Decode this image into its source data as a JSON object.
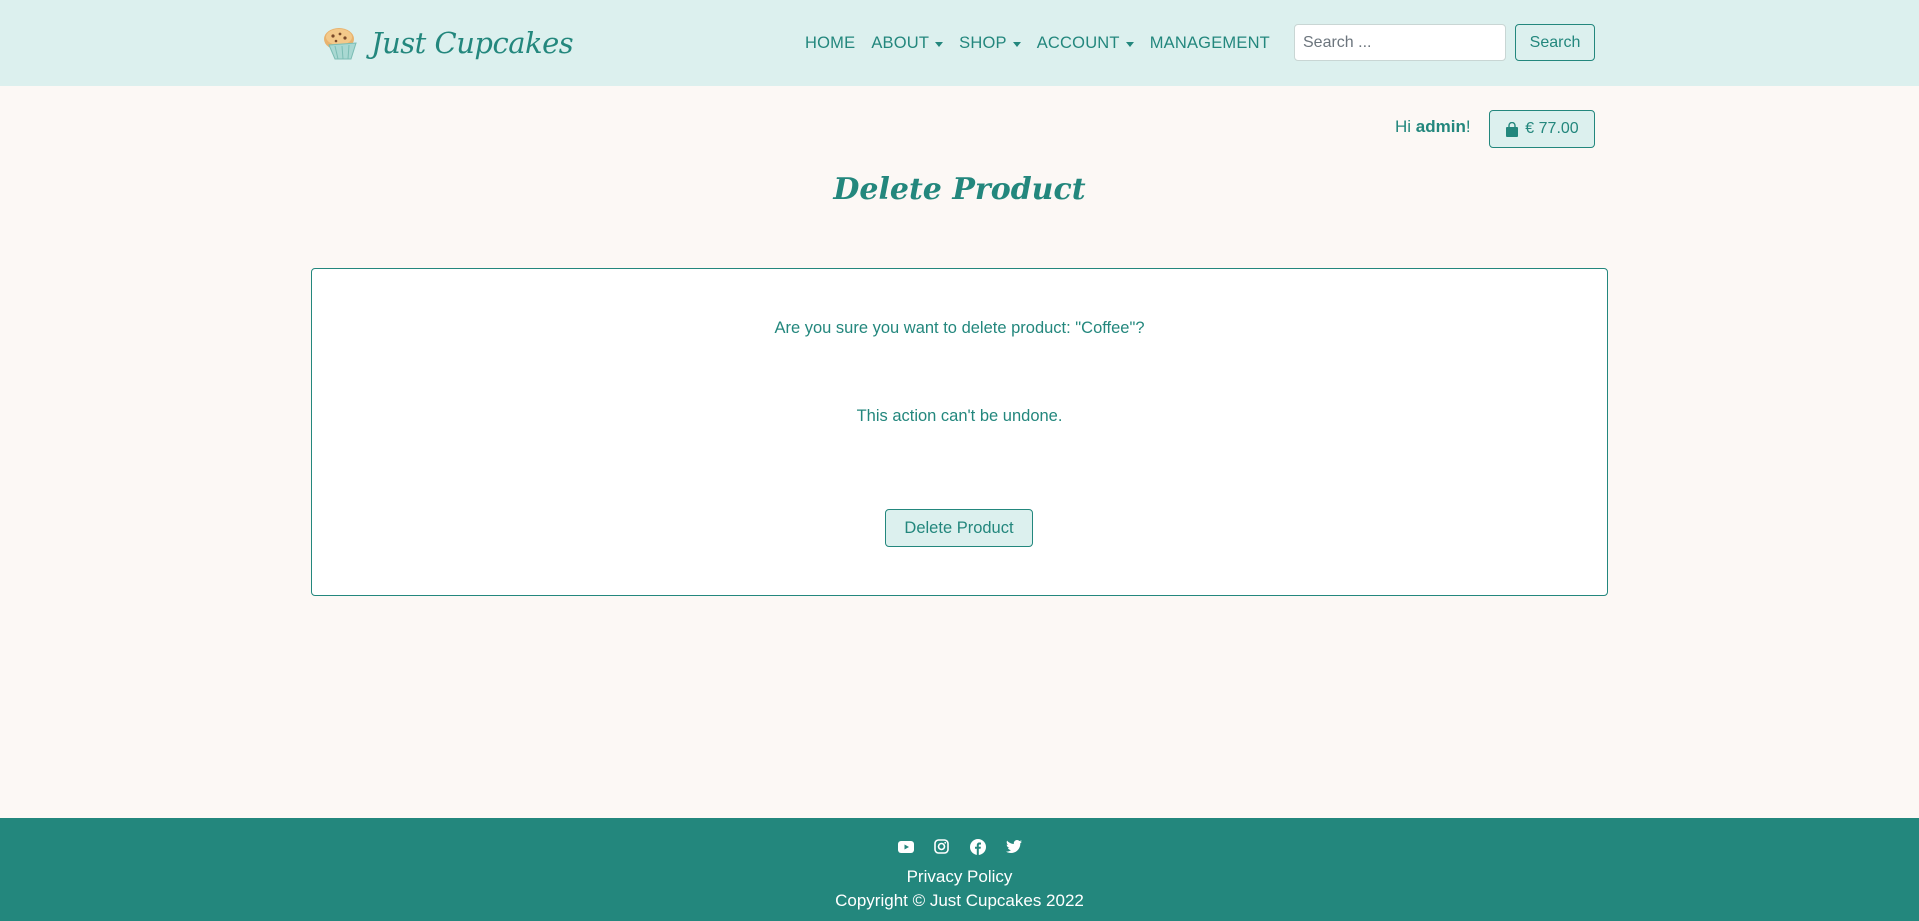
{
  "brand": {
    "name": "Just Cupcakes",
    "logo_icon": "cupcake-icon"
  },
  "nav": {
    "items": [
      {
        "label": "HOME",
        "dropdown": false
      },
      {
        "label": "ABOUT",
        "dropdown": true
      },
      {
        "label": "SHOP",
        "dropdown": true
      },
      {
        "label": "ACCOUNT",
        "dropdown": true
      },
      {
        "label": "MANAGEMENT",
        "dropdown": false
      }
    ],
    "search_placeholder": "Search ...",
    "search_button": "Search"
  },
  "user": {
    "greeting_prefix": "Hi ",
    "username": "admin",
    "greeting_suffix": "!",
    "cart_total": "€ 77.00",
    "cart_icon": "shopping-bag-icon"
  },
  "page": {
    "title": "Delete Product",
    "confirm_message": "Are you sure you want to delete product: \"Coffee\"?",
    "warning_message": "This action can't be undone.",
    "delete_button": "Delete Product"
  },
  "footer": {
    "socials": [
      "youtube-icon",
      "instagram-icon",
      "facebook-icon",
      "twitter-icon"
    ],
    "privacy_link": "Privacy Policy",
    "copyright": "Copyright © Just Cupcakes 2022"
  },
  "colors": {
    "primary": "#23877d",
    "header_bg": "#dcf0ee",
    "page_bg": "#fcf8f5",
    "footer_bg": "#23877d"
  }
}
